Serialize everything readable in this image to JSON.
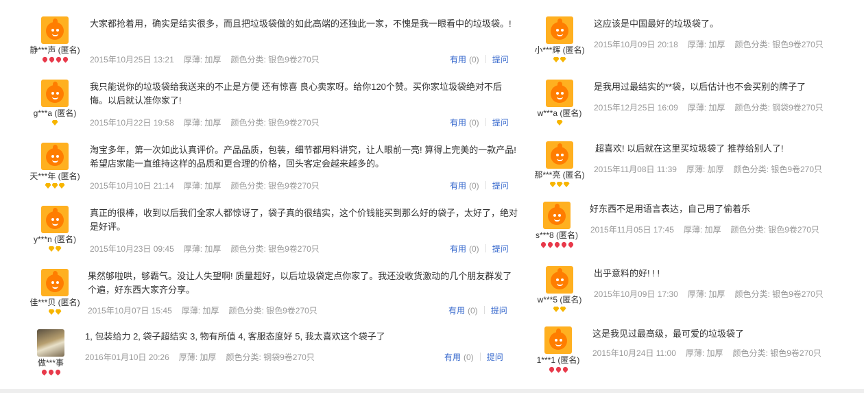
{
  "labels": {
    "thickness": "厚薄: 加厚",
    "useful": "有用",
    "reply": "提问"
  },
  "left_reviews": [
    {
      "user": "静***声 (匿名)",
      "rank": "red4",
      "text": "大家都抢着用，确实是结实很多，而且把垃圾袋做的如此高端的还独此一家，不愧是我一眼看中的垃圾袋。!",
      "date": "2015年10月25日 13:21",
      "color": "颜色分类: 银色9卷270只",
      "count": "(0)"
    },
    {
      "user": "g***a (匿名)",
      "rank": "yellow1",
      "text": "我只能说你的垃圾袋给我送来的不止是方便 还有惊喜 良心卖家呀。给你120个赞。买你家垃圾袋绝对不后悔。以后就认准你家了!",
      "date": "2015年10月22日 19:58",
      "color": "颜色分类: 银色9卷270只",
      "count": "(0)"
    },
    {
      "user": "天***年 (匿名)",
      "rank": "yellow3",
      "text": "淘宝多年，第一次如此认真评价。产品品质，包装，细节都用料讲究，让人眼前一亮! 算得上完美的一款产品! 希望店家能一直维持这样的品质和更合理的价格，回头客定会越来越多的。",
      "date": "2015年10月10日 21:14",
      "color": "颜色分类: 银色9卷270只",
      "count": "(0)"
    },
    {
      "user": "y***n (匿名)",
      "rank": "yellow2",
      "text": "真正的很棒，收到以后我们全家人都惊讶了，袋子真的很结实，这个价钱能买到那么好的袋子，太好了，绝对是好评。",
      "date": "2015年10月23日 09:45",
      "color": "颜色分类: 银色9卷270只",
      "count": "(0)"
    },
    {
      "user": "佳***贝 (匿名)",
      "rank": "yellow2",
      "text": "果然够啦哄，够霸气。没让人失望啊! 质量超好，以后垃圾袋定点你家了。我还没收货激动的几个朋友群发了个遍，好东西大家齐分享。",
      "date": "2015年10月07日 15:45",
      "color": "颜色分类: 银色9卷270只",
      "count": "(0)"
    },
    {
      "user": "做***事",
      "rank": "red3",
      "text": "1, 包装给力 2, 袋子超结实 3, 物有所值 4, 客服态度好 5, 我太喜欢这个袋子了",
      "date": "2016年01月10日 20:26",
      "color": "颜色分类: 钢袋9卷270只",
      "count": "(0)"
    }
  ],
  "right_reviews": [
    {
      "user": "小***辉 (匿名)",
      "rank": "yellow2",
      "text": "这应该是中国最好的垃圾袋了。",
      "date": "2015年10月09日 20:18",
      "color": "颜色分类: 银色9卷270只"
    },
    {
      "user": "w***a (匿名)",
      "rank": "yellow1",
      "text": "是我用过最结实的**袋，以后估计也不会买别的牌子了",
      "date": "2015年12月25日 16:09",
      "color": "颜色分类: 钢袋9卷270只"
    },
    {
      "user": "那***亮 (匿名)",
      "rank": "yellow3",
      "text": "超喜欢! 以后就在这里买垃圾袋了 推荐给别人了!",
      "date": "2015年11月08日 11:39",
      "color": "颜色分类: 银色9卷270只"
    },
    {
      "user": "s***8 (匿名)",
      "rank": "red5",
      "text": "好东西不是用语言表达，自己用了偷着乐",
      "date": "2015年11月05日 17:45",
      "color": "颜色分类: 银色9卷270只"
    },
    {
      "user": "w***5 (匿名)",
      "rank": "yellow2",
      "text": "出乎意料的好! ! !",
      "date": "2015年10月09日 17:30",
      "color": "颜色分类: 银色9卷270只"
    },
    {
      "user": "1***1 (匿名)",
      "rank": "red3",
      "text": "这是我见过最高级，最可爱的垃圾袋了",
      "date": "2015年10月24日 11:00",
      "color": "颜色分类: 银色9卷270只"
    }
  ]
}
